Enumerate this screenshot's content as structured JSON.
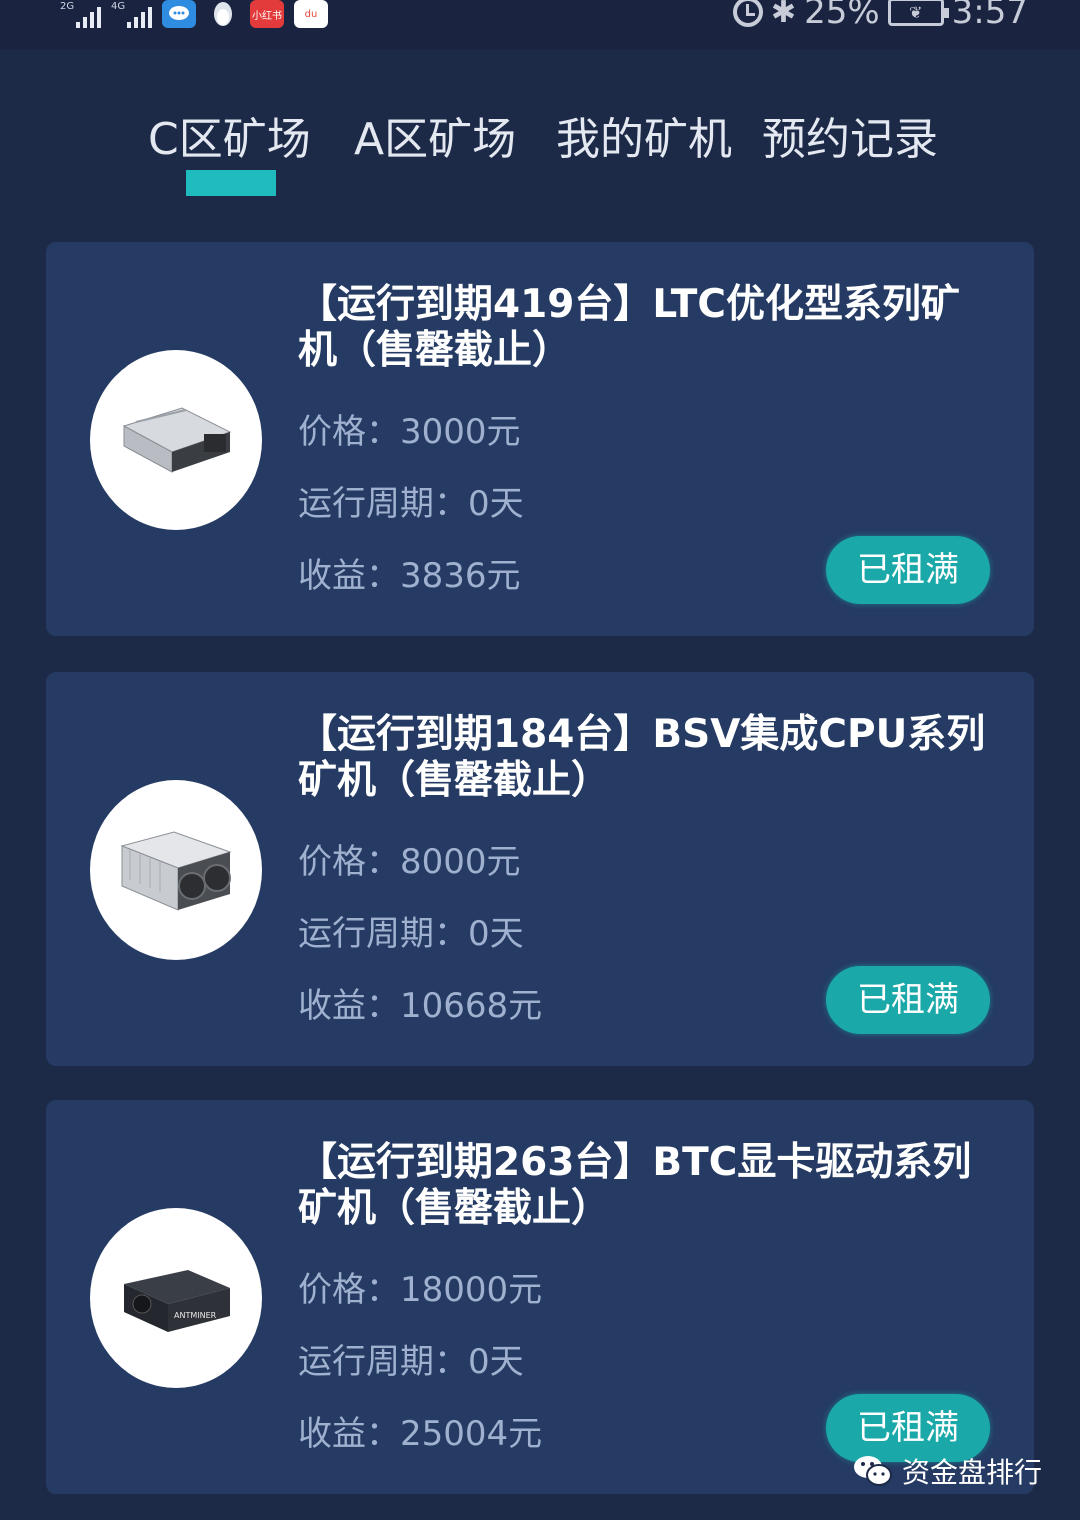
{
  "status_bar": {
    "signal_1": "2G",
    "signal_2": "4G",
    "apps": [
      {
        "name": "chat-app-icon",
        "label": ""
      },
      {
        "name": "penguin-app-icon",
        "label": ""
      },
      {
        "name": "xiaohongshu-app-icon",
        "label": "小红书"
      },
      {
        "name": "du-app-icon",
        "label": "du"
      }
    ],
    "battery": "25%",
    "time": "3:57"
  },
  "tabs": [
    {
      "label": "C区矿场",
      "active": true
    },
    {
      "label": "A区矿场",
      "active": false
    },
    {
      "label": "我的矿机",
      "active": false
    },
    {
      "label": "预约记录",
      "active": false
    }
  ],
  "cards": [
    {
      "title": "【运行到期419台】LTC优化型系列矿机（售罄截止）",
      "price_label": "价格：",
      "price": "3000元",
      "cycle_label": "运行周期：",
      "cycle": "0天",
      "income_label": "收益：",
      "income": "3836元",
      "button": "已租满",
      "image": "miner-silver-icon"
    },
    {
      "title": "【运行到期184台】BSV集成CPU系列矿机（售罄截止）",
      "price_label": "价格：",
      "price": "8000元",
      "cycle_label": "运行周期：",
      "cycle": "0天",
      "income_label": "收益：",
      "income": "10668元",
      "button": "已租满",
      "image": "miner-dual-fan-icon"
    },
    {
      "title": "【运行到期263台】BTC显卡驱动系列矿机（售罄截止）",
      "price_label": "价格：",
      "price": "18000元",
      "cycle_label": "运行周期：",
      "cycle": "0天",
      "income_label": "收益：",
      "income": "25004元",
      "button": "已租满",
      "image": "antminer-icon",
      "image_text": "ANTMINER"
    }
  ],
  "watermark": "资金盘排行",
  "colors": {
    "background": "#1c2947",
    "card": "#253b63",
    "accent": "#1fbbbe",
    "button": "#1aa8a9",
    "muted_text": "#9fb1cf"
  }
}
